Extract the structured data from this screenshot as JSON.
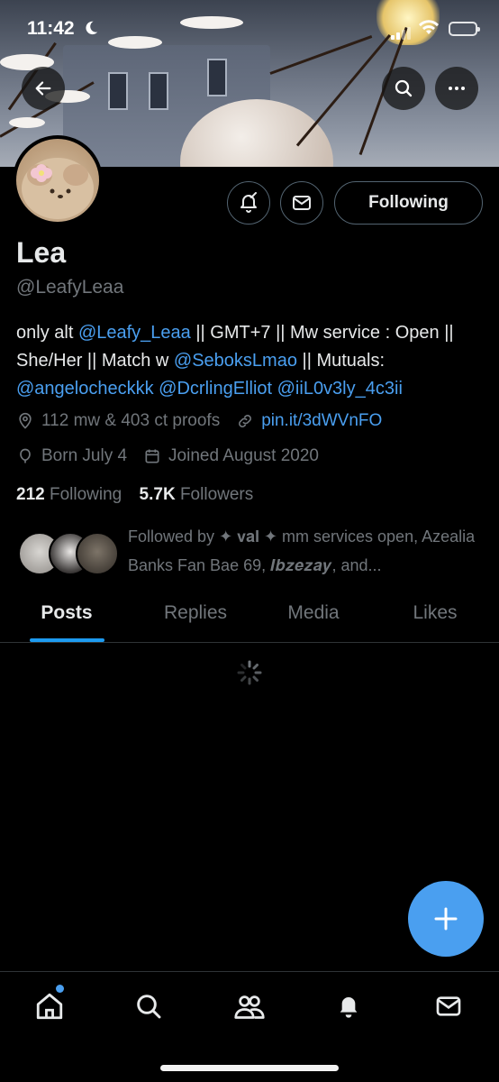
{
  "status_bar": {
    "time": "11:42"
  },
  "profile": {
    "name": "Lea",
    "handle": "@LeafyLeaa",
    "bio": {
      "t1": "only alt ",
      "m1": "@Leafy_Leaa",
      "t2": " || GMT+7 || Mw service : Open || She/Her || Match w ",
      "m2": "@SeboksLmao",
      "t3": " || Mutuals: ",
      "m3": "@angelocheckkk",
      "t4": " ",
      "m4": "@DcrlingElliot",
      "t5": " ",
      "m5": "@iiL0v3ly_4c3ii"
    },
    "location": "112 mw & 403 ct proofs",
    "website": "pin.it/3dWVnFO",
    "birthday": "Born July 4",
    "joined": "Joined August 2020",
    "following_count": "212",
    "following_label": "Following",
    "followers_count": "5.7K",
    "followers_label": "Followers",
    "followed_by": {
      "prefix": "Followed by ",
      "name1": "✦ 𝐯𝐚𝐥 ✦ mm services open",
      "sep1": ", ",
      "name2": "Azealia Banks Fan Bae 69",
      "sep2": ", ",
      "name3": "𝑰𝒃𝒛𝒆𝒛𝒂𝒚",
      "suffix": ", and..."
    }
  },
  "actions": {
    "following_button": "Following"
  },
  "tabs": [
    "Posts",
    "Replies",
    "Media",
    "Likes"
  ],
  "colors": {
    "accent": "#1d9bf0",
    "background": "#000000",
    "secondary_text": "#71767b"
  },
  "icons": {
    "back": "arrow-left-icon",
    "search": "search-icon",
    "more": "more-icon",
    "notify": "bell-check-icon",
    "message": "envelope-icon",
    "compose": "plus-icon"
  }
}
